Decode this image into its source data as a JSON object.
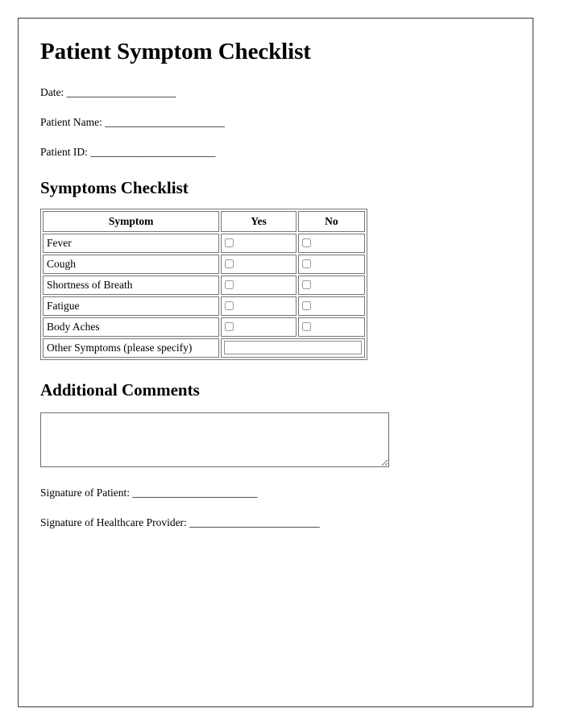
{
  "document": {
    "title": "Patient Symptom Checklist"
  },
  "header_fields": [
    {
      "label": "Date:",
      "blank": "_____________________"
    },
    {
      "label": "Patient Name:",
      "blank": "_______________________"
    },
    {
      "label": "Patient ID:",
      "blank": "________________________"
    }
  ],
  "checklist": {
    "heading": "Symptoms Checklist",
    "columns": [
      "Symptom",
      "Yes",
      "No"
    ],
    "rows": [
      {
        "symptom": "Fever",
        "yes": "",
        "no": ""
      },
      {
        "symptom": "Cough",
        "yes": "",
        "no": ""
      },
      {
        "symptom": "Shortness of Breath",
        "yes": "",
        "no": ""
      },
      {
        "symptom": "Fatigue",
        "yes": "",
        "no": ""
      },
      {
        "symptom": "Body Aches",
        "yes": "",
        "no": ""
      }
    ],
    "other_row": {
      "label": "Other Symptoms (please specify)",
      "value": "",
      "placeholder": ""
    }
  },
  "comments": {
    "heading": "Additional Comments",
    "value": "",
    "placeholder": ""
  },
  "signatures": [
    {
      "label": "Signature of Patient:",
      "blank": "________________________"
    },
    {
      "label": "Signature of Healthcare Provider:",
      "blank": "_________________________"
    }
  ]
}
